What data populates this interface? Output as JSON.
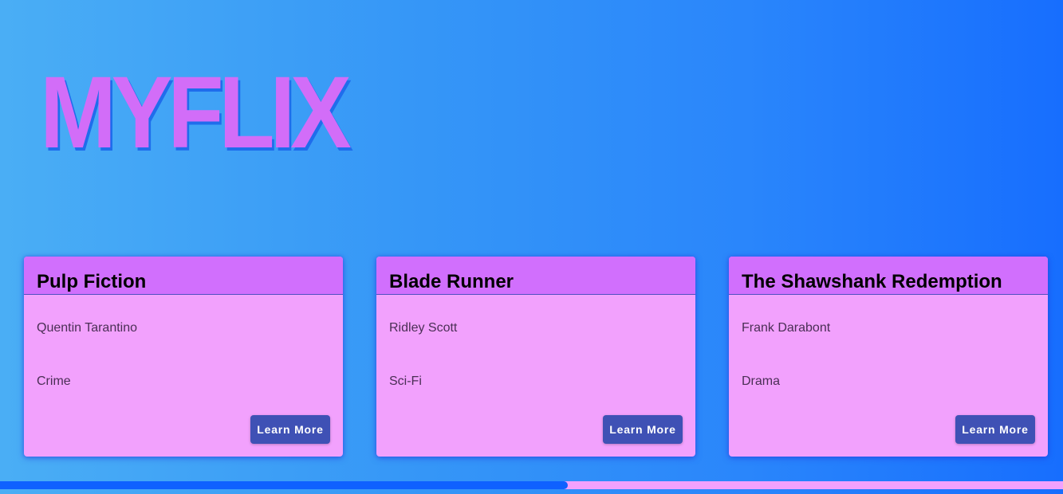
{
  "app": {
    "logo": "MYFLIX"
  },
  "movies": [
    {
      "title": "Pulp Fiction",
      "director": "Quentin Tarantino",
      "genre": "Crime",
      "button_label": "Learn More"
    },
    {
      "title": "Blade Runner",
      "director": "Ridley Scott",
      "genre": "Sci-Fi",
      "button_label": "Learn More"
    },
    {
      "title": "The Shawshank Redemption",
      "director": "Frank Darabont",
      "genre": "Drama",
      "button_label": "Learn More"
    }
  ],
  "scroll_progress": {
    "percent": 53.4
  },
  "colors": {
    "background_start": "#4aaef5",
    "background_end": "#176efe",
    "logo": "#d26df8",
    "card_header": "#d16ffd",
    "card_body": "#f2a1fd",
    "button": "#3f51b5",
    "progress_fill": "#0f61ff",
    "progress_track": "#f2a1fd"
  }
}
